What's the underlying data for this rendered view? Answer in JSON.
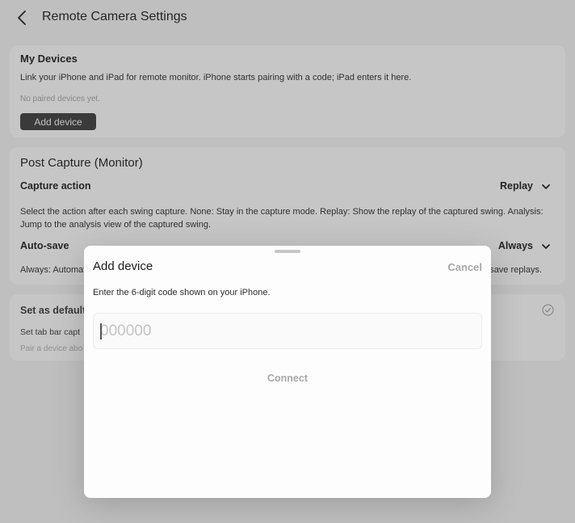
{
  "header": {
    "title": "Remote Camera Settings",
    "back_icon": "chevron-left-icon"
  },
  "my_devices": {
    "title": "My Devices",
    "description": "Link your iPhone and iPad for remote monitor. iPhone starts pairing with a code; iPad enters it here.",
    "empty_text": "No paired devices yet.",
    "add_button": "Add device"
  },
  "post_capture": {
    "title": "Post Capture (Monitor)",
    "capture_action": {
      "label": "Capture action",
      "value": "Replay",
      "description": "Select the action after each swing capture. None: Stay in the capture mode. Replay: Show the replay of the captured swing. Analysis: Jump to the analysis view of the captured swing."
    },
    "auto_save": {
      "label": "Auto-save",
      "value": "Always",
      "description_start": "Always: Automat",
      "description_end": "save replays."
    }
  },
  "set_default": {
    "label": "Set as default",
    "description": "Set tab bar capt",
    "hint": "Pair a device abo",
    "check_icon": "checkmark-circle-icon"
  },
  "modal": {
    "title": "Add device",
    "cancel": "Cancel",
    "instructions": "Enter the 6-digit code shown on your iPhone.",
    "code_value": "",
    "code_placeholder": "000000",
    "connect": "Connect"
  },
  "colors": {
    "background": "#f0f0f0",
    "card": "#fafafa",
    "primary_button": "#3a3a3c",
    "disabled_text": "#a8a8a8"
  }
}
